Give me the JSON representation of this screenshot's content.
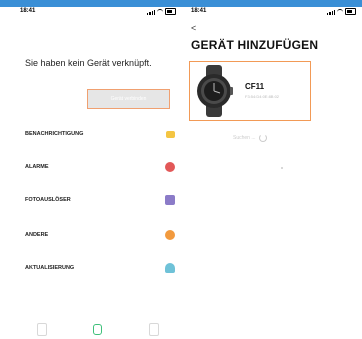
{
  "left_screen": {
    "status": {
      "time": "18:41"
    },
    "empty_message": "Sie haben kein Gerät verknüpft.",
    "connect_button": "Gerät verbinden",
    "menu": [
      {
        "label": "BENACHRICHTIGUNG",
        "icon": "message-icon",
        "color": "#f4c542"
      },
      {
        "label": "ALARME",
        "icon": "alarm-icon",
        "color": "#e25858"
      },
      {
        "label": "FOTOAUSLÖSER",
        "icon": "camera-icon",
        "color": "#8b7bc8"
      },
      {
        "label": "ANDERE",
        "icon": "gear-icon",
        "color": "#f29a3e"
      },
      {
        "label": "AKTUALISIERUNG",
        "icon": "update-icon",
        "color": "#6fc2d8"
      }
    ],
    "bottom_nav": [
      "device-tab-icon",
      "watch-tab-icon",
      "profile-tab-icon"
    ],
    "accent": "#3ec07a"
  },
  "right_screen": {
    "status": {
      "time": "18:41"
    },
    "back": "<",
    "title": "GERÄT HINZUFÜGEN",
    "device": {
      "name": "CF11",
      "mac": "F3:54:D4:0E:8B:02"
    },
    "searching": "Suchen ..."
  },
  "colors": {
    "top_bar": "#3a8fd6",
    "highlight_border": "#f29a56"
  }
}
